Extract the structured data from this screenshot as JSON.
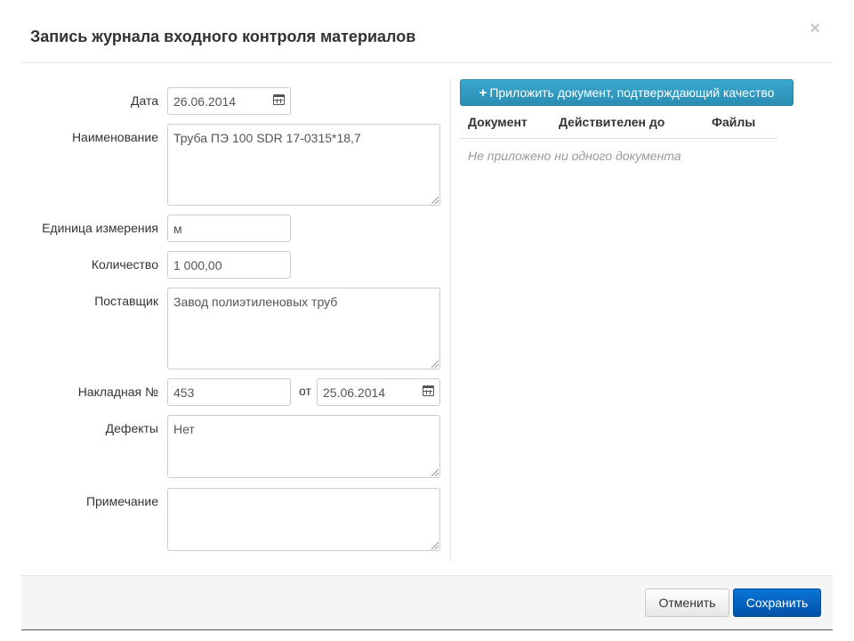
{
  "modal": {
    "title": "Запись журнала входного контроля материалов",
    "close_symbol": "×"
  },
  "form": {
    "date": {
      "label": "Дата",
      "value": "26.06.2014",
      "icon": "calendar-icon"
    },
    "name": {
      "label": "Наименование",
      "value": "Труба ПЭ 100 SDR 17-0315*18,7"
    },
    "unit": {
      "label": "Единица измерения",
      "value": "м"
    },
    "quantity": {
      "label": "Количество",
      "value": "1 000,00"
    },
    "supplier": {
      "label": "Поставщик",
      "value": "Завод полиэтиленовых труб"
    },
    "invoice": {
      "label": "Накладная №",
      "number": "453",
      "from_label": "от",
      "date": "25.06.2014",
      "icon": "calendar-icon"
    },
    "defects": {
      "label": "Дефекты",
      "value": "Нет"
    },
    "note": {
      "label": "Примечание",
      "value": ""
    }
  },
  "documents": {
    "attach_button": {
      "icon": "plus-icon",
      "label": "Приложить документ, подтверждающий качество"
    },
    "columns": [
      "Документ",
      "Действителен до",
      "Файлы"
    ],
    "empty_text": "Не приложено ни одного документа"
  },
  "footer": {
    "cancel_label": "Отменить",
    "save_label": "Сохранить"
  },
  "colors": {
    "attach_button": "#2f9ec4",
    "save_button": "#0062c4",
    "footer_bg": "#f5f5f5"
  }
}
